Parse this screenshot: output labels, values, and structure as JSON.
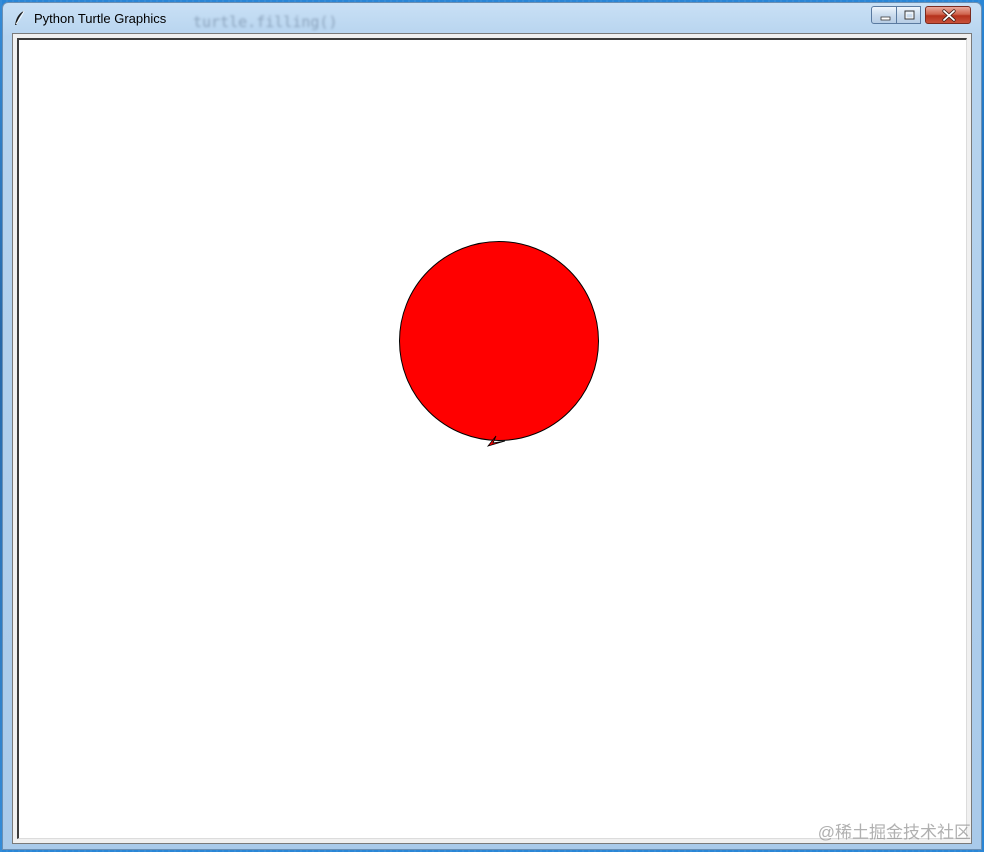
{
  "window": {
    "title": "Python Turtle Graphics",
    "background_code_hint": "turtle.filling()",
    "title_icon": "feather-icon",
    "controls": {
      "minimize_icon": "minimize-icon",
      "maximize_icon": "maximize-icon",
      "close_icon": "close-icon"
    }
  },
  "canvas": {
    "background": "#ffffff",
    "shape": {
      "kind": "filled-circle",
      "fill": "#ff0000",
      "stroke": "#000000",
      "turtle_cursor": "classic-arrow"
    }
  },
  "watermark": {
    "text": "@稀土掘金技术社区"
  }
}
